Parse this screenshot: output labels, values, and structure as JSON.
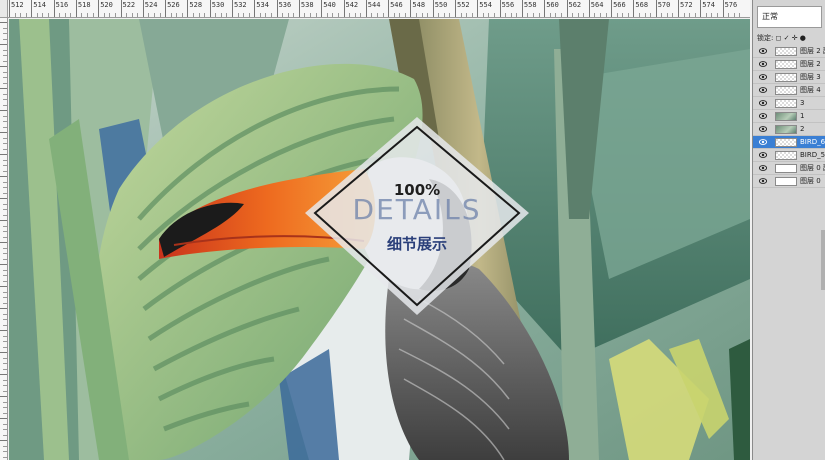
{
  "ruler": {
    "labels": [
      "512",
      "514",
      "516",
      "518",
      "520",
      "522",
      "524",
      "526",
      "528",
      "530",
      "532",
      "534",
      "536",
      "538",
      "540",
      "542",
      "544",
      "546",
      "548",
      "550",
      "552",
      "554",
      "556",
      "558",
      "560",
      "562",
      "564",
      "566",
      "568",
      "570",
      "572",
      "574",
      "576"
    ]
  },
  "badge": {
    "percent": "100%",
    "word": "DETAILS",
    "subtitle_cn": "细节展示"
  },
  "layers_panel": {
    "blend_mode": "正常",
    "lock_label": "锁定: ◻ ✓ ✛ ●",
    "layers": [
      {
        "name": "图层 2 副本",
        "thumb": "checker"
      },
      {
        "name": "图层 2",
        "thumb": "checker"
      },
      {
        "name": "图层 3",
        "thumb": "checker"
      },
      {
        "name": "图层 4",
        "thumb": "checker"
      },
      {
        "name": "3",
        "thumb": "checker"
      },
      {
        "name": "1",
        "thumb": "img"
      },
      {
        "name": "2",
        "thumb": "img"
      },
      {
        "name": "BIRD_6",
        "thumb": "checker",
        "selected": true
      },
      {
        "name": "BIRD_5",
        "thumb": "checker"
      },
      {
        "name": "图层 0 副本",
        "thumb": "blank"
      },
      {
        "name": "图层 0",
        "thumb": "blank"
      }
    ]
  },
  "colors": {
    "selection": "#3a7fd4",
    "beak": "#e9641f",
    "foliage_dark": "#4c7a63",
    "foliage_light": "#a9c78b"
  }
}
